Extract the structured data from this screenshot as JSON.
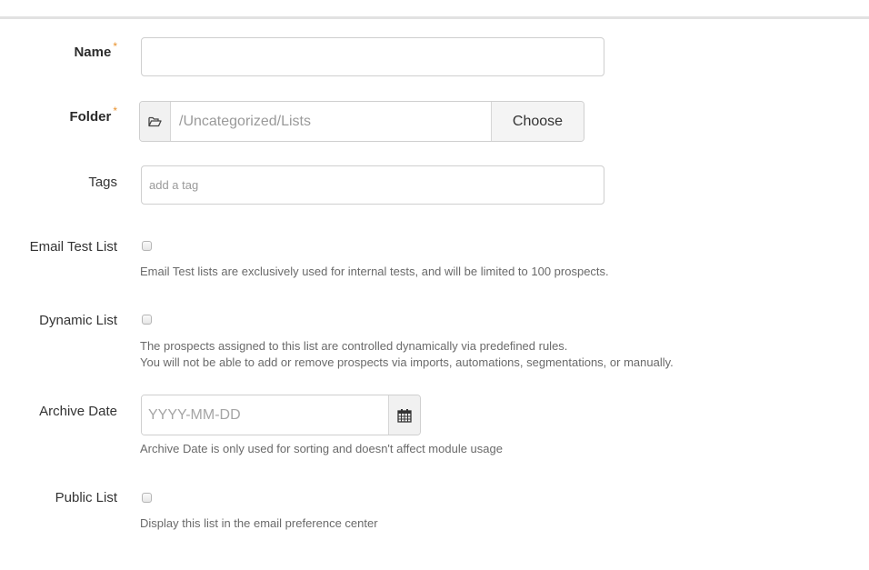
{
  "form": {
    "name": {
      "label": "Name",
      "required_mark": "*",
      "value": "",
      "placeholder": ""
    },
    "folder": {
      "label": "Folder",
      "required_mark": "*",
      "icon": "folder-open-icon",
      "path": "/Uncategorized/Lists",
      "choose_label": "Choose"
    },
    "tags": {
      "label": "Tags",
      "placeholder": "add a tag",
      "value": ""
    },
    "email_test_list": {
      "label": "Email Test List",
      "checked": false,
      "help": "Email Test lists are exclusively used for internal tests, and will be limited to 100 prospects."
    },
    "dynamic_list": {
      "label": "Dynamic List",
      "checked": false,
      "help_line1": "The prospects assigned to this list are controlled dynamically via predefined rules.",
      "help_line2": "You will not be able to add or remove prospects via imports, automations, segmentations, or manually."
    },
    "archive_date": {
      "label": "Archive Date",
      "placeholder": "YYYY-MM-DD",
      "value": "",
      "icon": "calendar-icon",
      "help": "Archive Date is only used for sorting and doesn't affect module usage"
    },
    "public_list": {
      "label": "Public List",
      "checked": false,
      "help": "Display this list in the email preference center"
    }
  },
  "colors": {
    "required": "#e8912d"
  }
}
